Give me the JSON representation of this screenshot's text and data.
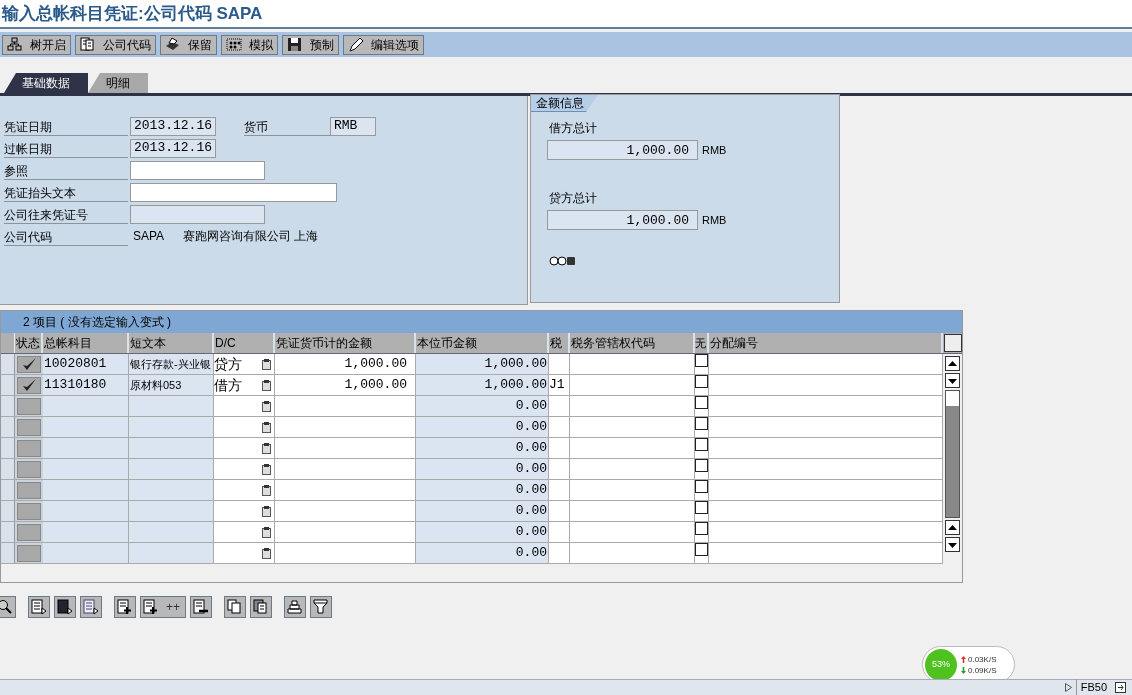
{
  "window": {
    "title": "输入总帐科目凭证:公司代码 SAPA"
  },
  "toolbar": [
    "树开启",
    "公司代码",
    "保留",
    "模拟",
    "预制",
    "编辑选项"
  ],
  "tabs": [
    {
      "label": "基础数据",
      "selected": true
    },
    {
      "label": "明细",
      "selected": false
    }
  ],
  "header_fields": [
    {
      "label": "凭证日期",
      "value": "2013.12.16",
      "kind": "date"
    },
    {
      "label": "过帐日期",
      "value": "2013.12.16",
      "kind": "date"
    },
    {
      "label": "参照",
      "kind": "short"
    },
    {
      "label": "凭证抬头文本",
      "kind": "long"
    },
    {
      "label": "公司往来凭证号",
      "kind": "readonly"
    },
    {
      "label": "公司代码",
      "value": "SAPA",
      "description": "赛跑网咨询有限公司 上海",
      "kind": "text"
    }
  ],
  "currency": {
    "label": "货币",
    "value": "RMB"
  },
  "amount_info": {
    "title": "金额信息",
    "debit_label": "借方总计",
    "debit_value": "1,000.00",
    "debit_currency": "RMB",
    "credit_label": "贷方总计",
    "credit_value": "1,000.00",
    "credit_currency": "RMB"
  },
  "table": {
    "title": "2 项目 ( 没有选定输入变式 )",
    "columns": [
      "状态",
      "总帐科目",
      "短文本",
      "D/C",
      "凭证货币计的金额",
      "本位币金额",
      "税",
      "税务管辖权代码",
      "无",
      "分配编号"
    ],
    "rows": [
      {
        "status_ok": true,
        "account": "10020801",
        "text": "银行存款-兴业银",
        "dc": "贷方",
        "amount": "1,000.00",
        "local": "1,000.00",
        "tax": "",
        "checked": false
      },
      {
        "status_ok": true,
        "account": "11310180",
        "text": "原材料053",
        "dc": "借方",
        "amount": "1,000.00",
        "local": "1,000.00",
        "tax": "J1",
        "checked": false
      },
      {
        "status_ok": false,
        "local": "0.00",
        "checked": false
      },
      {
        "status_ok": false,
        "local": "0.00",
        "checked": false
      },
      {
        "status_ok": false,
        "local": "0.00",
        "checked": false
      },
      {
        "status_ok": false,
        "local": "0.00",
        "checked": false
      },
      {
        "status_ok": false,
        "local": "0.00",
        "checked": false
      },
      {
        "status_ok": false,
        "local": "0.00",
        "checked": false
      },
      {
        "status_ok": false,
        "local": "0.00",
        "checked": false
      },
      {
        "status_ok": false,
        "local": "0.00",
        "checked": false
      }
    ]
  },
  "bottom_toolbar": {
    "insert_many_label": "++"
  },
  "net_meter": {
    "percent": "53%",
    "upload": "0.03K/S",
    "download": "0.09K/S"
  },
  "status_bar": {
    "transaction": "FB50"
  }
}
